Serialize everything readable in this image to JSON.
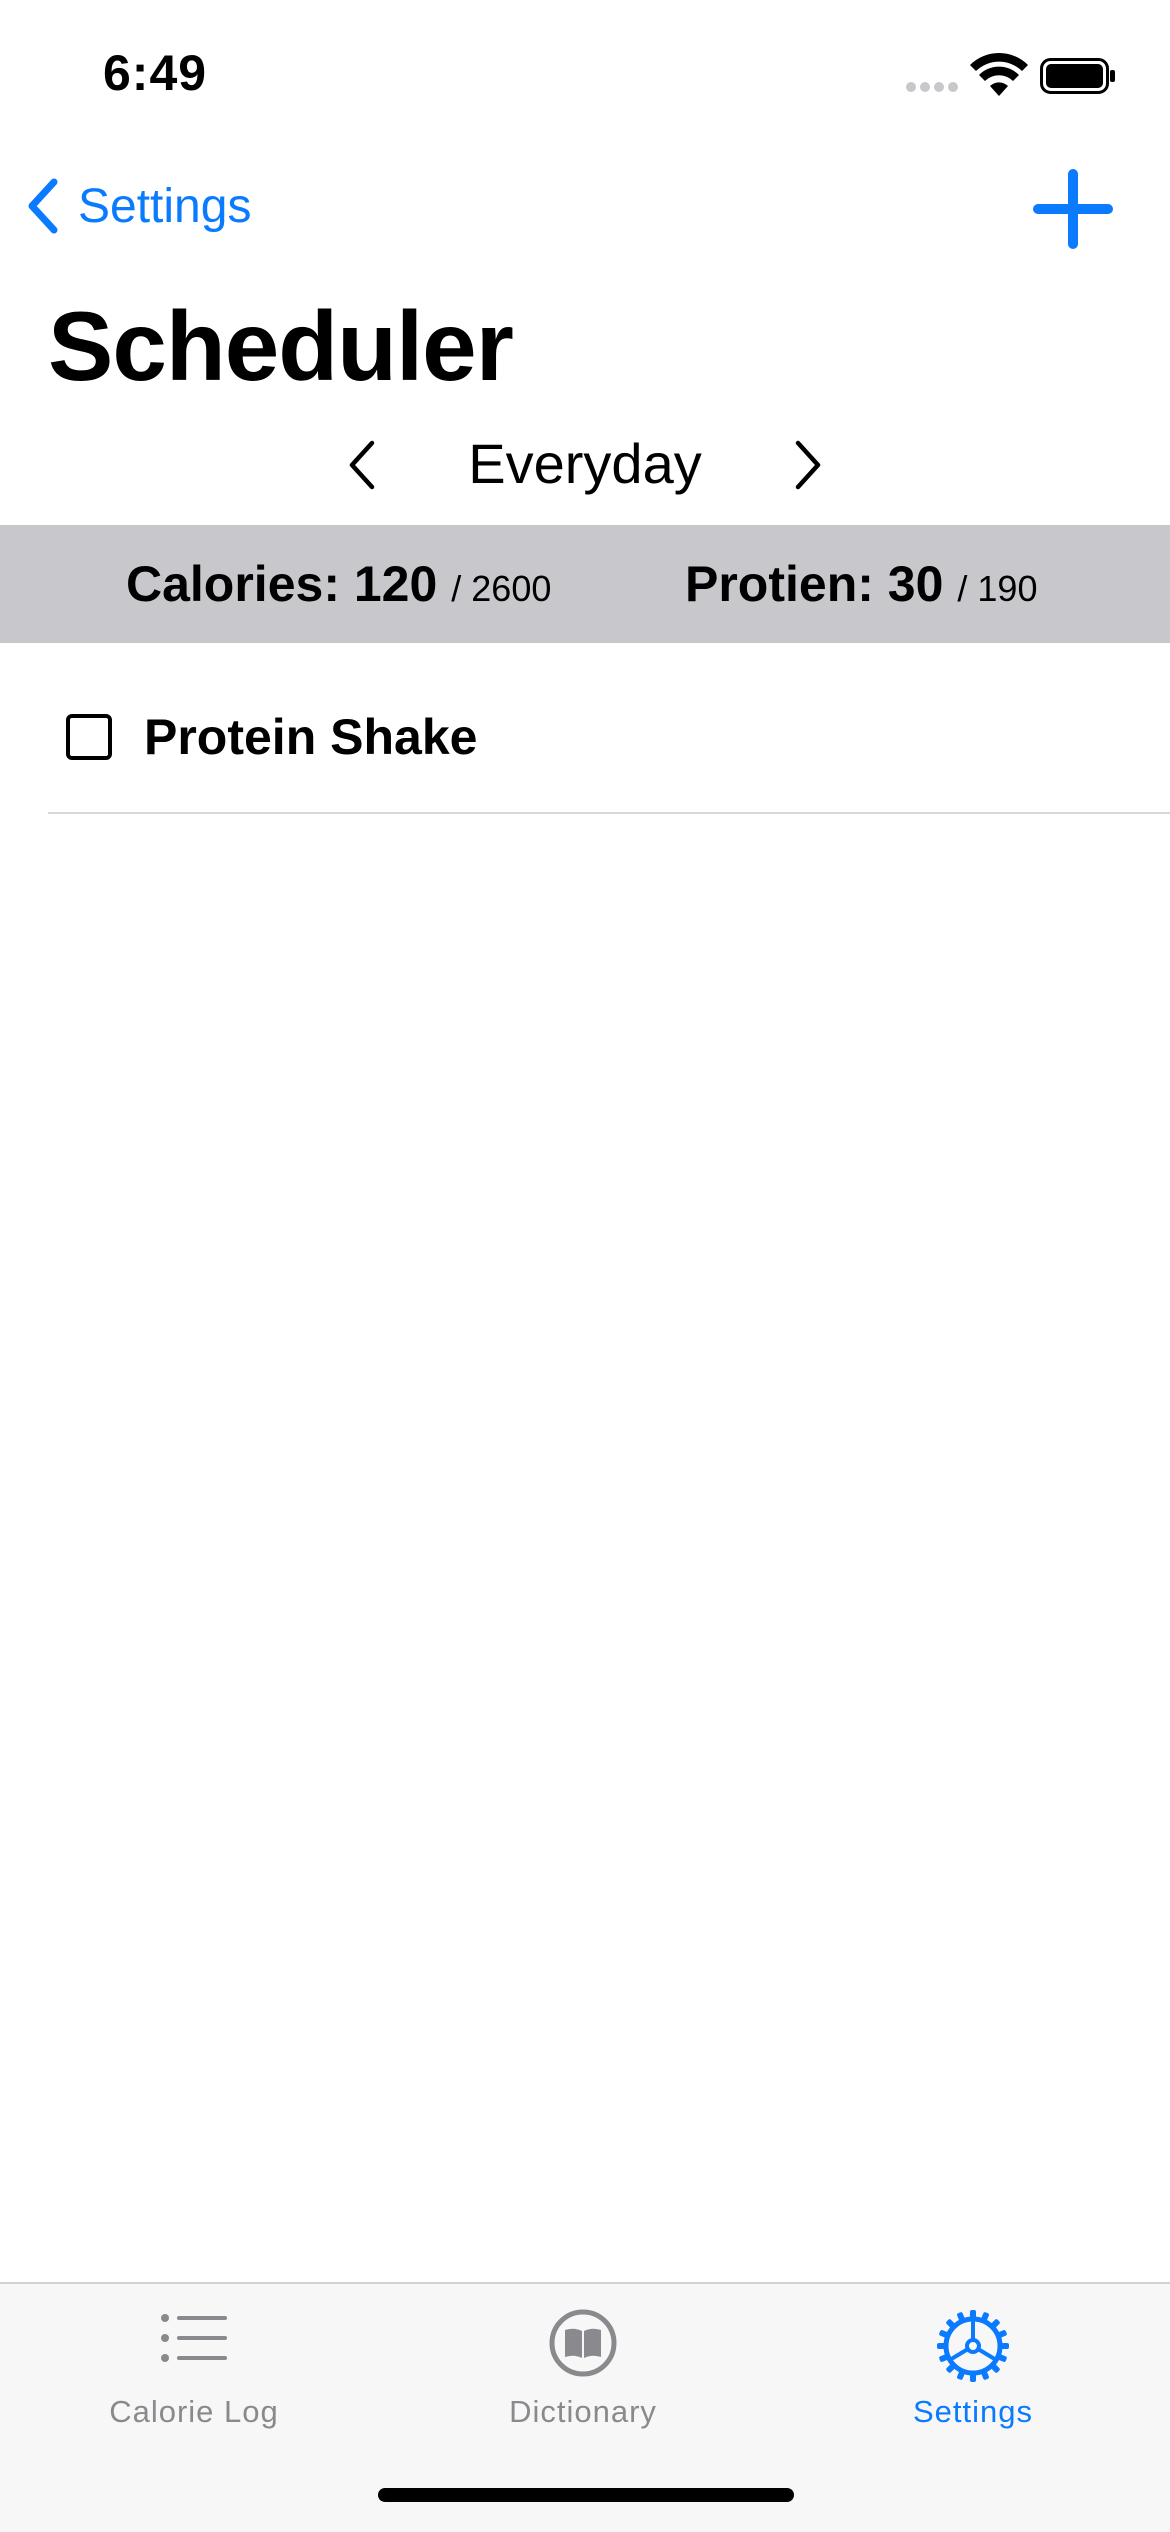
{
  "status_bar": {
    "time": "6:49"
  },
  "nav": {
    "back_label": "Settings",
    "title": "Scheduler",
    "add_icon": "plus-icon"
  },
  "day_selector": {
    "label": "Everyday"
  },
  "summary": {
    "calories_label": "Calories: 120",
    "calories_goal": "/ 2600",
    "protein_label": "Protien: 30",
    "protein_goal": "/ 190"
  },
  "items": [
    {
      "name": "Protein Shake",
      "checked": false
    }
  ],
  "tabs": [
    {
      "label": "Calorie Log",
      "icon": "list-icon",
      "active": false
    },
    {
      "label": "Dictionary",
      "icon": "book-icon",
      "active": false
    },
    {
      "label": "Settings",
      "icon": "gear-icon",
      "active": true
    }
  ],
  "colors": {
    "accent": "#0a7aff",
    "summary_background": "#c7c7cc",
    "tab_inactive": "#8a8a8e"
  }
}
